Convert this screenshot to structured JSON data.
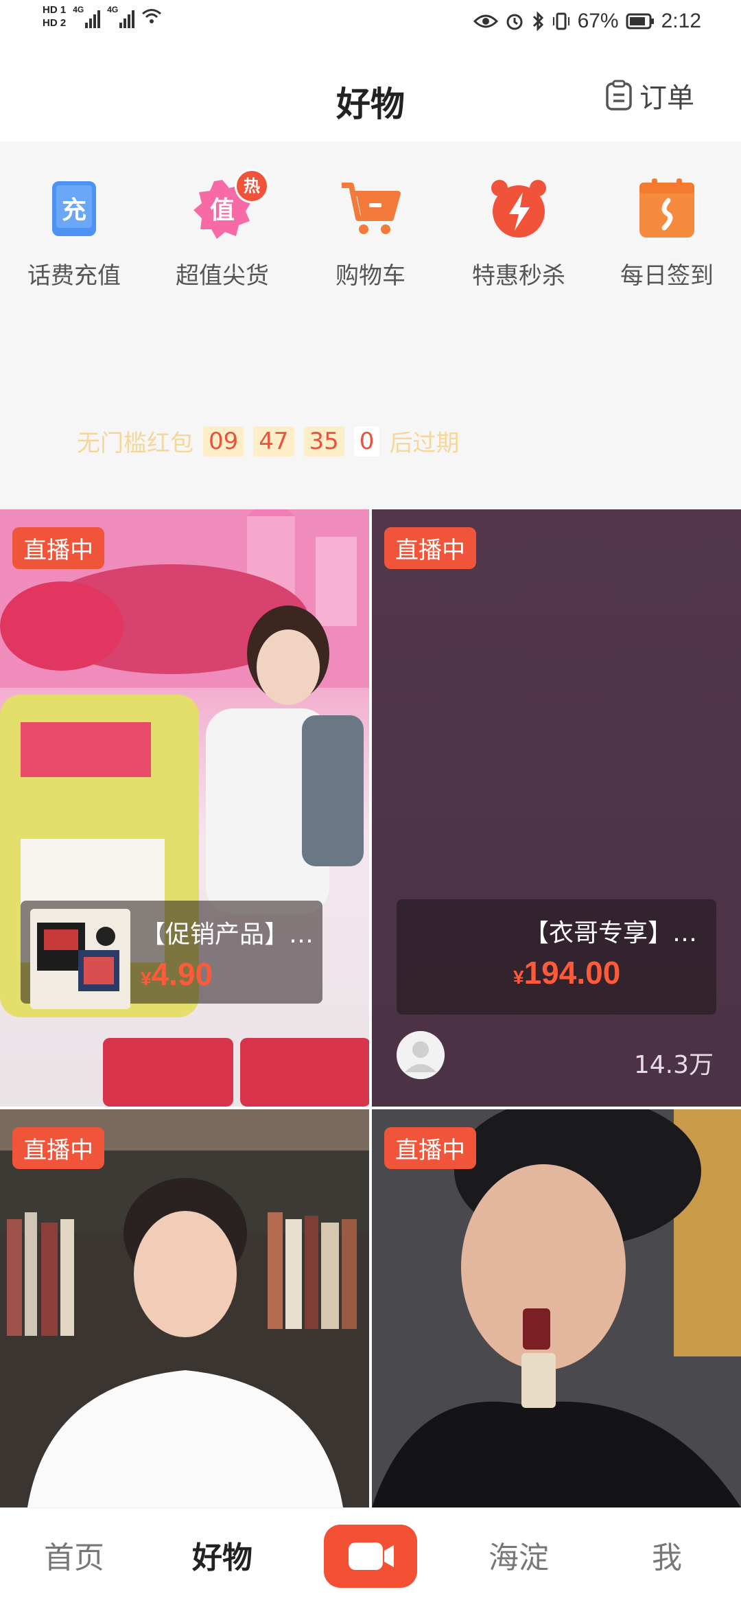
{
  "status_bar": {
    "sim1": "HD 1",
    "sim2": "HD 2",
    "net1": "4G",
    "net2": "4G",
    "battery": "67%",
    "time": "2:12"
  },
  "header": {
    "title": "好物",
    "orders_label": "订单"
  },
  "quick_menu": [
    {
      "label": "话费充值",
      "icon_char": "充",
      "icon": "phone-topup-icon"
    },
    {
      "label": "超值尖货",
      "icon_char": "值",
      "icon": "value-goods-icon",
      "badge": "热"
    },
    {
      "label": "购物车",
      "icon": "cart-icon"
    },
    {
      "label": "特惠秒杀",
      "icon": "flash-sale-icon"
    },
    {
      "label": "每日签到",
      "icon": "daily-checkin-icon"
    }
  ],
  "countdown": {
    "prefix": "无门槛红包",
    "hours": "09",
    "minutes": "47",
    "seconds": "35",
    "fraction": "0",
    "suffix": "后过期"
  },
  "streams": [
    {
      "badge": "直播中",
      "product_name": "【促销产品】…",
      "currency": "¥",
      "price": "4.90"
    },
    {
      "badge": "直播中",
      "product_name": "【衣哥专享】…",
      "currency": "¥",
      "price": "194.00",
      "viewers": "14.3万"
    },
    {
      "badge": "直播中"
    },
    {
      "badge": "直播中"
    }
  ],
  "tabs": [
    {
      "label": "首页",
      "active": false
    },
    {
      "label": "好物",
      "active": true
    },
    {
      "label": "海淀",
      "active": false
    },
    {
      "label": "我",
      "active": false
    }
  ],
  "colors": {
    "accent": "#f0553a",
    "price": "#ff5a3a",
    "countdown_text": "#f5d79a"
  }
}
